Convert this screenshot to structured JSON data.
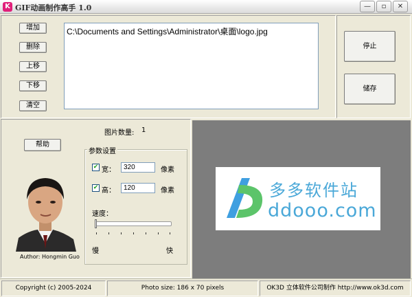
{
  "window": {
    "title": "GIF动画制作高手 1.0",
    "app_icon_letter": "K",
    "minimize_glyph": "—",
    "maximize_glyph": "▫",
    "close_glyph": "✕"
  },
  "file_buttons": {
    "add": "增加",
    "delete": "删除",
    "move_up": "上移",
    "move_down": "下移",
    "clear": "清空"
  },
  "file_list": [
    "C:\\Documents and Settings\\Administrator\\桌面\\logo.jpg"
  ],
  "actions": {
    "stop": "停止",
    "save": "储存"
  },
  "help_button": "帮助",
  "image_count": {
    "label": "图片数量:",
    "value": "1"
  },
  "author_caption": "Author: Hongmin Guo",
  "params": {
    "group_title": "参数设置",
    "width_label": "宽：",
    "width_value": "320",
    "width_unit": "像素",
    "width_checked": true,
    "height_label": "高：",
    "height_value": "120",
    "height_unit": "像素",
    "height_checked": true,
    "speed_label": "速度：",
    "speed_slow": "慢",
    "speed_fast": "快",
    "speed_level": 0
  },
  "preview_logo": {
    "cn_text": "多多软件站",
    "en_text": "ddooo.com",
    "brand_color": "#4aa8d8"
  },
  "status": {
    "copyright": "Copyright (c) 2005-2024",
    "photo_size": "Photo size:  186 x 70 pixels",
    "maker": "OK3D 立体软件公司制作 http://www.ok3d.com"
  },
  "colors": {
    "window_bg": "#ece9d8",
    "preview_bg": "#7d7d7d"
  }
}
